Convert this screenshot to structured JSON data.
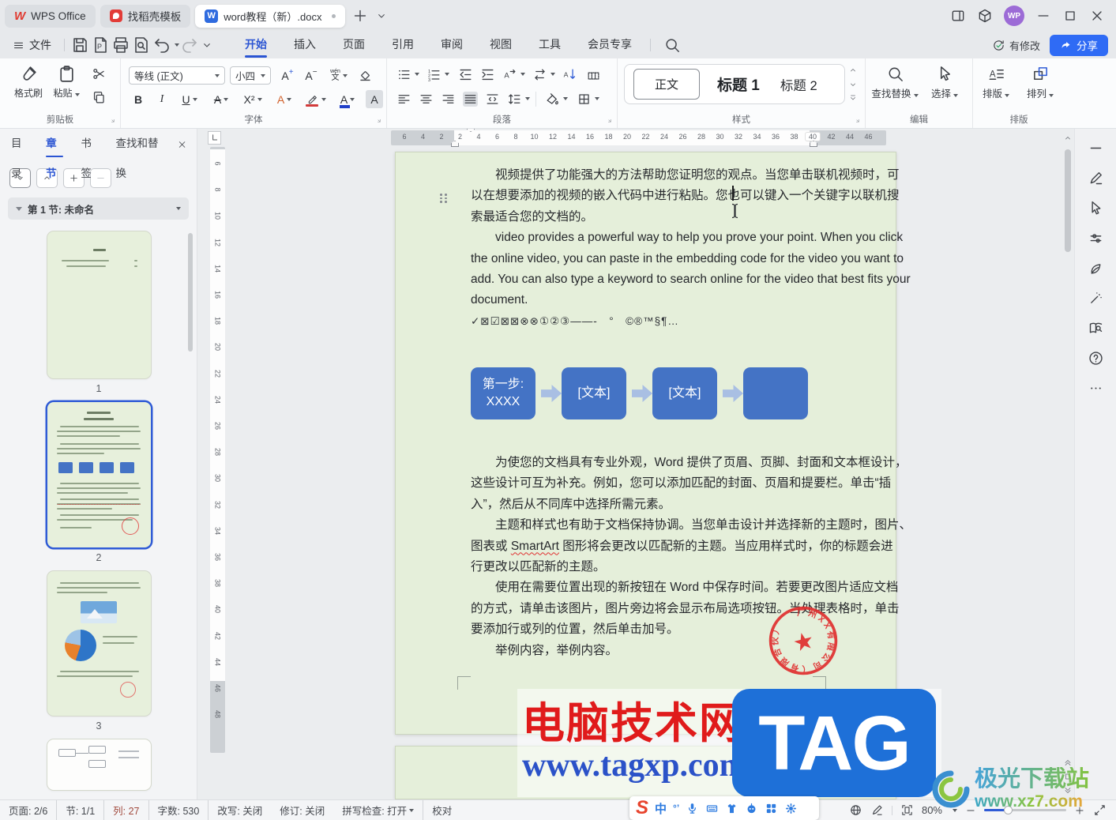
{
  "titlebar": {
    "tab_wps": "WPS Office",
    "tab_docer": "找稻壳模板",
    "tab_doc": "word教程（新）.docx",
    "avatar": "WP"
  },
  "menubar": {
    "file": "文件",
    "items": [
      "开始",
      "插入",
      "页面",
      "引用",
      "审阅",
      "视图",
      "工具",
      "会员专享"
    ],
    "active": "开始",
    "modified": "有修改",
    "share": "分享"
  },
  "ribbon": {
    "clipboard": {
      "label": "剪贴板",
      "format_painter": "格式刷",
      "paste": "粘贴"
    },
    "font": {
      "label": "字体",
      "family": "等线 (正文)",
      "size": "小四",
      "bold": "B",
      "italic": "I",
      "underline": "U",
      "strike": "A",
      "sup": "X²",
      "effect": "A",
      "color": "A",
      "shade": "A",
      "pinyin_top": "wén",
      "pinyin_bot": "文"
    },
    "paragraph": {
      "label": "段落"
    },
    "styles": {
      "label": "样式",
      "normal": "正文",
      "heading1": "标题 1",
      "heading2": "标题 2"
    },
    "editing": {
      "label": "编辑",
      "find_replace": "查找替换",
      "select": "选择"
    },
    "typeset": {
      "label": "排版",
      "layout": "排版",
      "arrange": "排列"
    }
  },
  "navpanel": {
    "tabs": [
      "目录",
      "章节",
      "书签",
      "查找和替换"
    ],
    "active": "章节",
    "section": "第 1 节: 未命名",
    "pages": [
      "1",
      "2",
      "3"
    ]
  },
  "ruler": {
    "h": [
      "6",
      "4",
      "2",
      "2",
      "4",
      "6",
      "8",
      "10",
      "12",
      "14",
      "16",
      "18",
      "20",
      "22",
      "24",
      "26",
      "28",
      "30",
      "32",
      "34",
      "36",
      "38",
      "40",
      "42",
      "44",
      "46"
    ],
    "h_highlight": "40",
    "v": [
      "6",
      "8",
      "10",
      "12",
      "14",
      "16",
      "18",
      "20",
      "22",
      "24",
      "26",
      "28",
      "30",
      "32",
      "34",
      "36",
      "38",
      "40",
      "42",
      "44",
      "46",
      "48"
    ]
  },
  "doc": {
    "para1": [
      "视频提供了功能强大的方法帮助您证明您的观点。当您单击联机视频时，可",
      "以在想要添加的视频的嵌入代码中进行粘贴。您也可以键入一个关键字以联机搜",
      "索最适合您的文档的。"
    ],
    "para2": [
      "video provides a powerful way to help you prove your point. When you click",
      "the online video, you can paste in the embedding code for the video you want to",
      "add. You can also type a keyword to search online for the video that best fits your",
      "document."
    ],
    "symbols": "✓⊠☑⊠⊠⊗⊗①②③——-　°　©®™§¶…",
    "flow_boxes": [
      {
        "line1": "第一步:",
        "line2": "XXXX"
      },
      {
        "line1": "[文本]",
        "line2": ""
      },
      {
        "line1": "[文本]",
        "line2": ""
      },
      {
        "line1": "",
        "line2": ""
      }
    ],
    "para3": [
      "为使您的文档具有专业外观，Word 提供了页眉、页脚、封面和文本框设计，",
      "这些设计可互为补充。例如，您可以添加匹配的封面、页眉和提要栏。单击“插",
      "入”，然后从不同库中选择所需元素。"
    ],
    "para4_l1": "主题和样式也有助于文档保持协调。当您单击设计并选择新的主题时，图片、",
    "para4_l2a": "图表或 ",
    "para4_misspell": "SmartArt",
    "para4_l2b": " 图形将会更改以匹配新的主题。当应用样式时，你的标题会进",
    "para4_l3": "行更改以匹配新的主题。",
    "para5": [
      "使用在需要位置出现的新按钮在 Word 中保存时间。若要更改图片适应文档",
      "的方式，请单击该图片，图片旁边将会显示布局选项按钮。当处理表格时，单击",
      "要添加行或列的位置，然后单击加号。"
    ],
    "para6": "举例内容，举例内容。",
    "stamp_text": "广州XX有限公司（有限合伙）"
  },
  "statusbar": {
    "items": [
      {
        "t": "页面: 2/6",
        "div": true
      },
      {
        "t": "节: 1/1",
        "div": true
      },
      {
        "t": "列: 27",
        "div": true,
        "accent": true
      },
      {
        "t": "字数: 530",
        "div": true
      },
      {
        "t": "改写: 关闭"
      },
      {
        "t": "修订: 关闭"
      },
      {
        "t": "拼写检查: 打开",
        "dd": true,
        "div": true
      },
      {
        "t": "校对"
      }
    ],
    "zoom": "80%"
  },
  "ime": {
    "logo": "S",
    "mode": "中",
    "punct": "°’"
  },
  "watermarks": {
    "site_name": "电脑技术网",
    "site_url": "www.tagxp.com",
    "site_badge": "TAG",
    "dl_name": "极光下载站",
    "dl_url": "www.xz7.com"
  },
  "colors": {
    "accent_blue": "#2b55d3",
    "share_blue": "#2f6bf5",
    "page_green": "#e5efda",
    "flow_box_blue": "#4473c5",
    "stamp_red": "#e02f2f",
    "watermark_red": "#e01b1b",
    "watermark_blue": "#1e70d8"
  }
}
